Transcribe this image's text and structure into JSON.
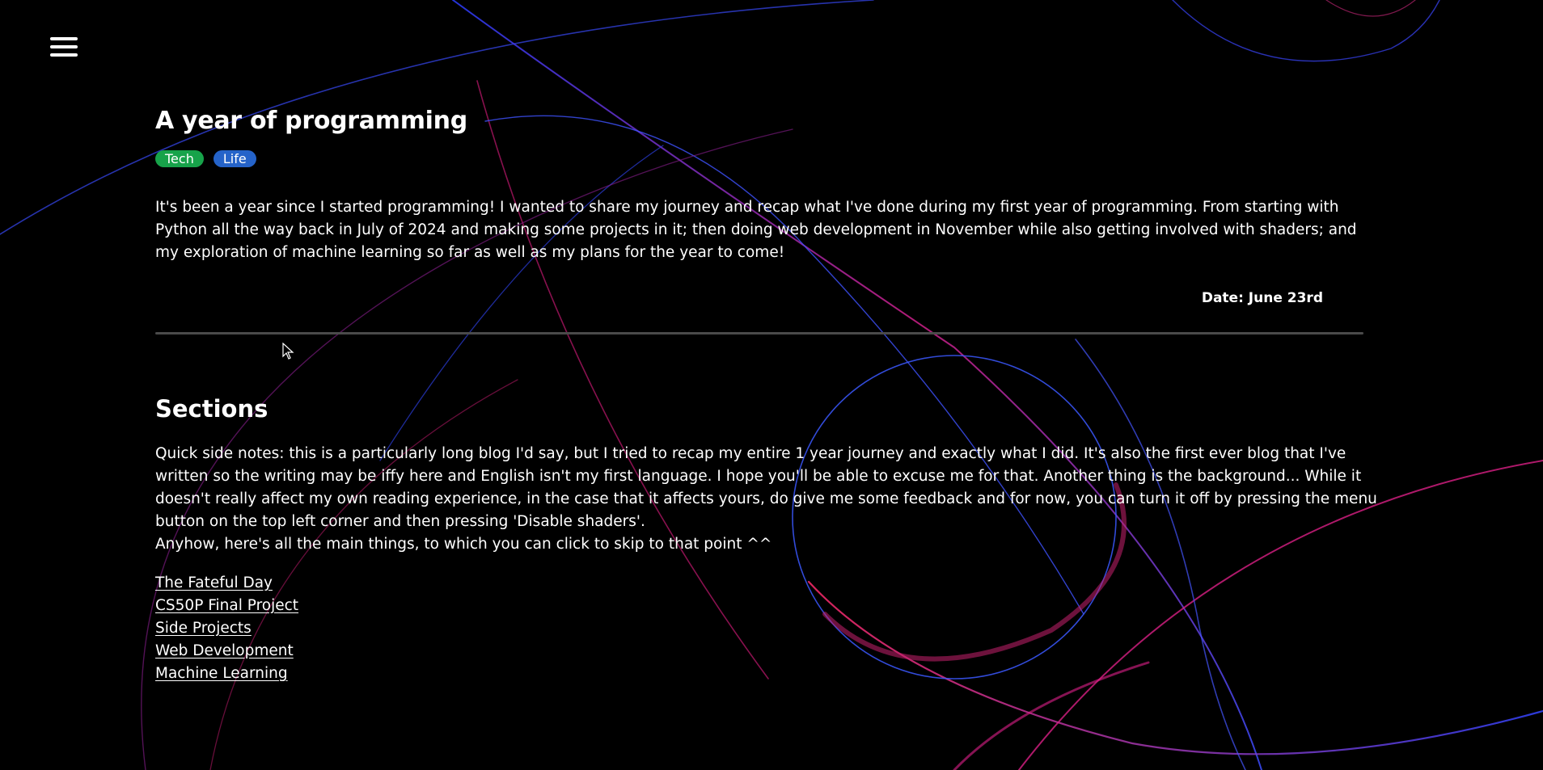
{
  "menu": {
    "icon": "hamburger-menu-icon"
  },
  "post": {
    "title": "A year of programming",
    "tags": [
      {
        "label": "Tech",
        "color": "#17a34a"
      },
      {
        "label": "Life",
        "color": "#2563c9"
      }
    ],
    "intro": "It's been a year since I started programming! I wanted to share my journey and recap what I've done during my first year of programming. From starting with Python all the way back in July of 2024 and making some projects in it; then doing web development in November while also getting involved with shaders; and my exploration of machine learning so far as well as my plans for the year to come!",
    "date": "Date: June 23rd"
  },
  "sections": {
    "heading": "Sections",
    "note": "Quick side notes: this is a particularly long blog I'd say, but I tried to recap my entire 1 year journey and exactly what I did. It's also the first ever blog that I've written so the writing may be iffy here and English isn't my first language. I hope you'll be able to excuse me for that. Another thing is the background... While it doesn't really affect my own reading experience, in the case that it affects yours, do give me some feedback and for now, you can turn it off by pressing the menu button on the top left corner and then pressing 'Disable shaders'.",
    "skip_text": "Anyhow, here's all the main things, to which you can click to skip to that point ^^",
    "links": [
      "The Fateful Day",
      "CS50P Final Project",
      "Side Projects",
      "Web Development",
      "Machine Learning"
    ]
  },
  "colors": {
    "background": "#000000",
    "text": "#ffffff",
    "divider": "#4a4a4a"
  }
}
